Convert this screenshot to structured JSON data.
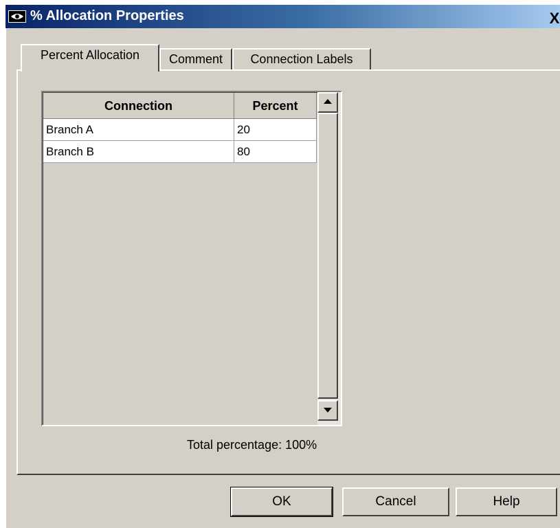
{
  "window": {
    "title": "% Allocation Properties",
    "close_symbol": "X",
    "title_icon": "eye-icon"
  },
  "tabs": [
    {
      "label": "Percent Allocation",
      "active": true
    },
    {
      "label": "Comment",
      "active": false
    },
    {
      "label": "Connection Labels",
      "active": false
    }
  ],
  "table": {
    "columns": [
      "Connection",
      "Percent"
    ],
    "rows": [
      {
        "connection": "Branch A",
        "percent": "20"
      },
      {
        "connection": "Branch B",
        "percent": "80"
      }
    ]
  },
  "total_text": "Total percentage: 100%",
  "buttons": {
    "ok": "OK",
    "cancel": "Cancel",
    "help": "Help"
  }
}
